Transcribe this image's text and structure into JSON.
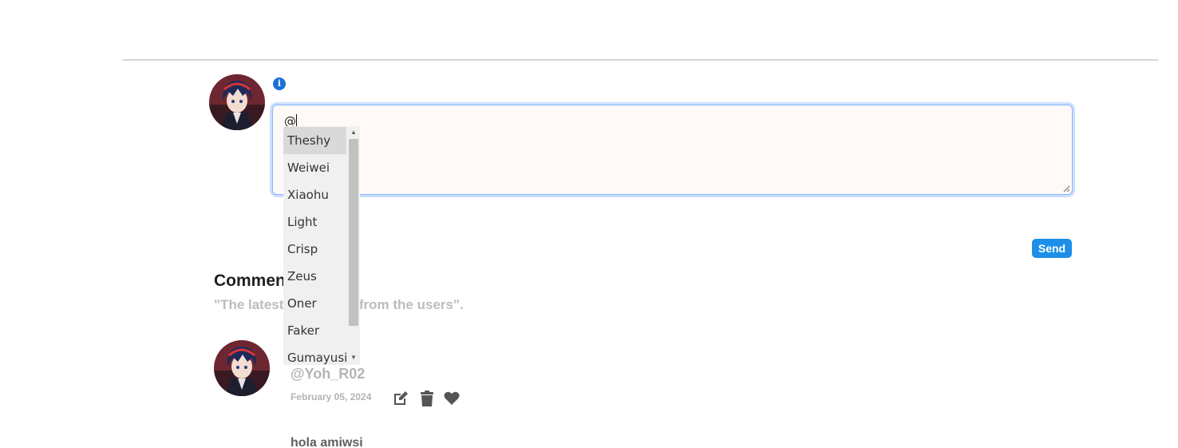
{
  "composer": {
    "info_icon": "info-icon",
    "text": "@",
    "mention_suggestions": [
      "Theshy",
      "Weiwei",
      "Xiaohu",
      "Light",
      "Crisp",
      "Zeus",
      "Oner",
      "Faker",
      "Gumayusi"
    ],
    "selected_index": 0,
    "send_label": "Send",
    "send_color": "#1d8fe8"
  },
  "comments_section": {
    "title": "Comments",
    "subtitle": "\"The latest comments from the users\"."
  },
  "comment": {
    "username": "@Yoh_R02",
    "date": "February 05, 2024",
    "actions": [
      "edit-icon",
      "trash-icon",
      "heart-icon"
    ],
    "body": "hola amiwsi"
  }
}
